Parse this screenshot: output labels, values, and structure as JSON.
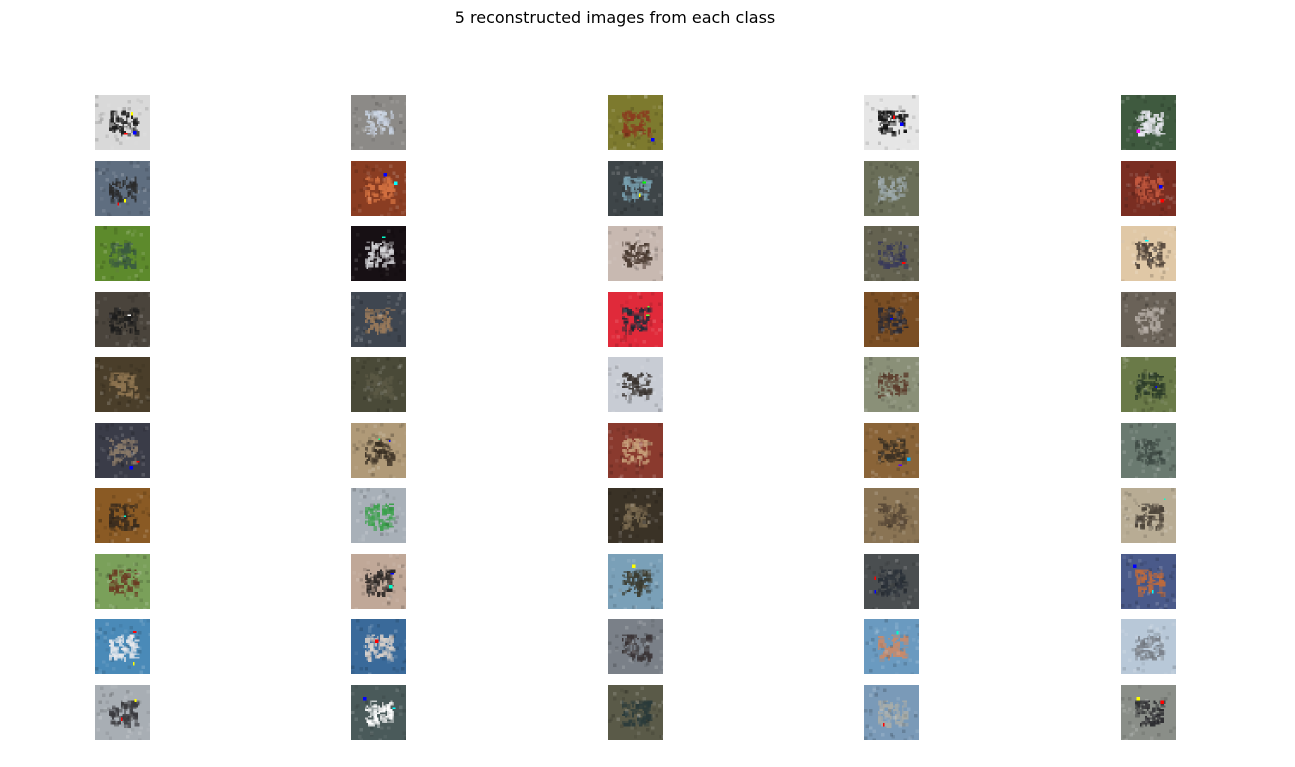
{
  "figure": {
    "title": "5 reconstructed images from each class"
  },
  "grid": {
    "rows": 10,
    "columns": 5,
    "images": [
      [
        {
          "bg": "#d9d9d9",
          "fg": "#1a1a1a",
          "spots": [
            "#ffff00",
            "#ff0000",
            "#0000ff"
          ]
        },
        {
          "bg": "#8c8a87",
          "fg": "#c7d1e0",
          "spots": []
        },
        {
          "bg": "#7d7a2e",
          "fg": "#8a3b1f",
          "spots": [
            "#0000ff"
          ]
        },
        {
          "bg": "#e6e6e6",
          "fg": "#111111",
          "spots": [
            "#ff0000",
            "#0000ff"
          ]
        },
        {
          "bg": "#3f5a3f",
          "fg": "#e8e8f0",
          "spots": [
            "#ff00ff"
          ]
        }
      ],
      [
        {
          "bg": "#5f6e80",
          "fg": "#2a2a2a",
          "spots": [
            "#ff0000",
            "#ffff00"
          ]
        },
        {
          "bg": "#8a3d22",
          "fg": "#d27040",
          "spots": [
            "#00ffff",
            "#0000ff"
          ]
        },
        {
          "bg": "#3e4548",
          "fg": "#78a0b0",
          "spots": [
            "#ffff00",
            "#00ff00"
          ]
        },
        {
          "bg": "#6a6e58",
          "fg": "#9aa6a8",
          "spots": []
        },
        {
          "bg": "#7a2e22",
          "fg": "#c2583e",
          "spots": [
            "#0000ff",
            "#ff0000"
          ]
        }
      ],
      [
        {
          "bg": "#5d8a2c",
          "fg": "#3a5a40",
          "spots": []
        },
        {
          "bg": "#171014",
          "fg": "#d8d8dc",
          "spots": [
            "#00ffcc"
          ]
        },
        {
          "bg": "#c8b9b1",
          "fg": "#4a3a30",
          "spots": []
        },
        {
          "bg": "#646250",
          "fg": "#383a5a",
          "spots": [
            "#ff0000"
          ]
        },
        {
          "bg": "#e0c8a6",
          "fg": "#4a3e34",
          "spots": [
            "#00ffff"
          ]
        }
      ],
      [
        {
          "bg": "#4a443c",
          "fg": "#1c1c1c",
          "spots": [
            "#ffffff"
          ]
        },
        {
          "bg": "#3f4650",
          "fg": "#9a7a5a",
          "spots": []
        },
        {
          "bg": "#e02a3a",
          "fg": "#1e2c38",
          "spots": [
            "#66ff33",
            "#66ff33"
          ]
        },
        {
          "bg": "#7a4e24",
          "fg": "#2a2a34",
          "spots": [
            "#0000ff"
          ]
        },
        {
          "bg": "#6a6258",
          "fg": "#b0a8a0",
          "spots": []
        }
      ],
      [
        {
          "bg": "#4a3e2a",
          "fg": "#8e7450",
          "spots": []
        },
        {
          "bg": "#4a4a38",
          "fg": "#5a5844",
          "spots": []
        },
        {
          "bg": "#c8ccd4",
          "fg": "#3a3430",
          "spots": []
        },
        {
          "bg": "#8a9078",
          "fg": "#5a3a2a",
          "spots": []
        },
        {
          "bg": "#6a7a48",
          "fg": "#2a3a28",
          "spots": [
            "#0000ff"
          ]
        }
      ],
      [
        {
          "bg": "#3a3c48",
          "fg": "#8a7a68",
          "spots": [
            "#ff0000",
            "#0000ff"
          ]
        },
        {
          "bg": "#b09a78",
          "fg": "#3a3024",
          "spots": [
            "#00ff88",
            "#0000ff"
          ]
        },
        {
          "bg": "#8a3a2e",
          "fg": "#c8a07a",
          "spots": []
        },
        {
          "bg": "#8a6438",
          "fg": "#3a3024",
          "spots": [
            "#5500ff",
            "#00aaff"
          ]
        },
        {
          "bg": "#6a7a70",
          "fg": "#3e4a44",
          "spots": []
        }
      ],
      [
        {
          "bg": "#8a5a24",
          "fg": "#3a2c1e",
          "spots": [
            "#00ffcc"
          ]
        },
        {
          "bg": "#a8b0b8",
          "fg": "#3aa04a",
          "spots": []
        },
        {
          "bg": "#3a3226",
          "fg": "#7a6a50",
          "spots": []
        },
        {
          "bg": "#8a7454",
          "fg": "#5a4a38",
          "spots": []
        },
        {
          "bg": "#b8ac94",
          "fg": "#4a4238",
          "spots": [
            "#00ffcc"
          ]
        }
      ],
      [
        {
          "bg": "#7aa05a",
          "fg": "#6a3a22",
          "spots": []
        },
        {
          "bg": "#c0a898",
          "fg": "#2a2624",
          "spots": [
            "#00ffcc",
            "#0000ff"
          ]
        },
        {
          "bg": "#7aa0b8",
          "fg": "#3a3a2e",
          "spots": [
            "#ffff00"
          ]
        },
        {
          "bg": "#4a4e50",
          "fg": "#2a3038",
          "spots": [
            "#ff0000",
            "#0000ff"
          ]
        },
        {
          "bg": "#4a5a8a",
          "fg": "#c06a3a",
          "spots": [
            "#00ffff",
            "#0000ff"
          ]
        }
      ],
      [
        {
          "bg": "#4a8ab8",
          "fg": "#e8e8ec",
          "spots": [
            "#ffff00",
            "#ff0000"
          ]
        },
        {
          "bg": "#3a6a9a",
          "fg": "#d8cfc8",
          "spots": [
            "#ff0000"
          ]
        },
        {
          "bg": "#7a8088",
          "fg": "#3a3436",
          "spots": []
        },
        {
          "bg": "#6a9ac0",
          "fg": "#c88a6a",
          "spots": [
            "#00ffcc"
          ]
        },
        {
          "bg": "#b8c8d8",
          "fg": "#7a8088",
          "spots": []
        }
      ],
      [
        {
          "bg": "#a8aeb4",
          "fg": "#3a3a3e",
          "spots": [
            "#ff0000",
            "#ffff00"
          ]
        },
        {
          "bg": "#4a5a5a",
          "fg": "#ffffff",
          "spots": [
            "#0000ff",
            "#00ffff"
          ]
        },
        {
          "bg": "#5a5a48",
          "fg": "#2a3a3a",
          "spots": []
        },
        {
          "bg": "#7a9ab8",
          "fg": "#a8aca8",
          "spots": [
            "#ff0000"
          ]
        },
        {
          "bg": "#8a8e88",
          "fg": "#2a2a2e",
          "spots": [
            "#ff0000",
            "#ffff00"
          ]
        }
      ]
    ]
  }
}
